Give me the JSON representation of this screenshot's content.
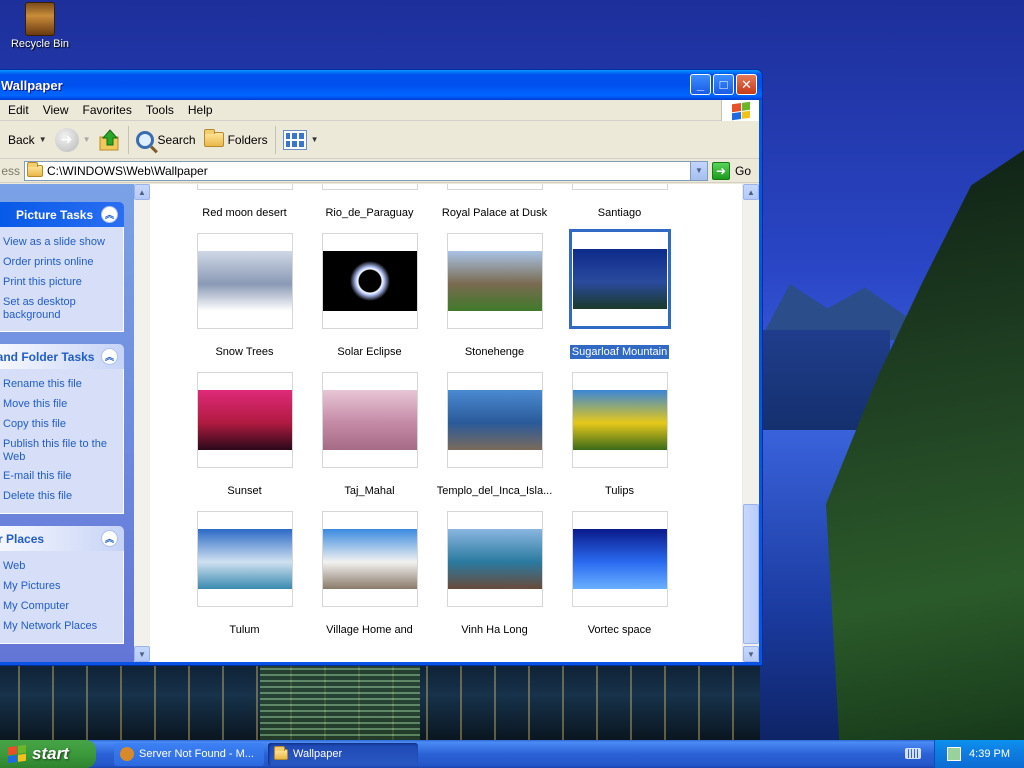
{
  "desktop": {
    "recycle_bin": {
      "label": "Recycle Bin",
      "icon": "recycle-bin-icon"
    }
  },
  "window": {
    "title": "Wallpaper",
    "controls": [
      "minimize",
      "maximize",
      "close"
    ],
    "menu": [
      "Edit",
      "View",
      "Favorites",
      "Tools",
      "Help"
    ],
    "toolbar": {
      "back": "Back",
      "search": "Search",
      "folders": "Folders"
    },
    "address": {
      "label": "ess",
      "path": "C:\\WINDOWS\\Web\\Wallpaper",
      "go": "Go"
    }
  },
  "taskpane": {
    "picture_tasks": {
      "title": "Picture Tasks",
      "items": [
        "View as a slide show",
        "Order prints online",
        "Print this picture",
        "Set as desktop background"
      ]
    },
    "file_folder_tasks": {
      "title": "ile and Folder Tasks",
      "items": [
        "Rename this file",
        "Move this file",
        "Copy this file",
        "Publish this file to the Web",
        "E-mail this file",
        "Delete this file"
      ]
    },
    "other_places": {
      "title": "ther Places",
      "items": [
        "Web",
        "My Pictures",
        "My Computer",
        "My Network Places"
      ]
    }
  },
  "files": [
    {
      "name": "Red moon desert",
      "colors": [
        "#5a1a0a",
        "#a2361a",
        "#c44a1e"
      ]
    },
    {
      "name": "Rio_de_Paraguay",
      "colors": [
        "#cfd8d0",
        "#6a8a5a",
        "#3e6a3a"
      ]
    },
    {
      "name": "Royal Palace at Dusk",
      "colors": [
        "#1a1430",
        "#6a4a2a",
        "#d1a04a"
      ]
    },
    {
      "name": "Santiago",
      "colors": [
        "#3a4a6a",
        "#6a6a7a",
        "#2a2a3a"
      ]
    },
    {
      "name": "Snow Trees",
      "colors": [
        "#cfd8e6",
        "#8a99b5",
        "#ffffff"
      ]
    },
    {
      "name": "Solar Eclipse",
      "colors": [
        "#000000",
        "#000000",
        "#000000"
      ]
    },
    {
      "name": "Stonehenge",
      "colors": [
        "#a9c3e6",
        "#7a6a50",
        "#3f7a2a"
      ]
    },
    {
      "name": "Sugarloaf Mountain",
      "colors": [
        "#0d2a8a",
        "#2a4a9e",
        "#1a3a2a"
      ]
    },
    {
      "name": "Sunset",
      "colors": [
        "#e02a7a",
        "#b01a40",
        "#2a0a1a"
      ]
    },
    {
      "name": "Taj_Mahal",
      "colors": [
        "#e8c6d6",
        "#c48aa6",
        "#a46a86"
      ]
    },
    {
      "name": "Templo_del_Inca_Isla...",
      "colors": [
        "#4a8ad0",
        "#2a5a9a",
        "#7a6a5a"
      ]
    },
    {
      "name": "Tulips",
      "colors": [
        "#3a86d6",
        "#e6c81a",
        "#3a6a1a"
      ]
    },
    {
      "name": "Tulum",
      "colors": [
        "#2a6ac6",
        "#cfe0f0",
        "#3a8ab0"
      ]
    },
    {
      "name": "Village Home and",
      "colors": [
        "#3a8ae0",
        "#f2f2f0",
        "#8a7a6a"
      ]
    },
    {
      "name": "Vinh Ha Long",
      "colors": [
        "#8ab6e0",
        "#2a7aa0",
        "#6a4a3a"
      ]
    },
    {
      "name": "Vortec space",
      "colors": [
        "#0a1a8a",
        "#2a6af0",
        "#6ab0ff"
      ]
    }
  ],
  "selected_file": "Sugarloaf Mountain",
  "taskbar": {
    "start": "start",
    "tasks": [
      "Server Not Found - M...",
      "Wallpaper"
    ],
    "active_task": "Wallpaper",
    "clock": "4:39 PM"
  }
}
